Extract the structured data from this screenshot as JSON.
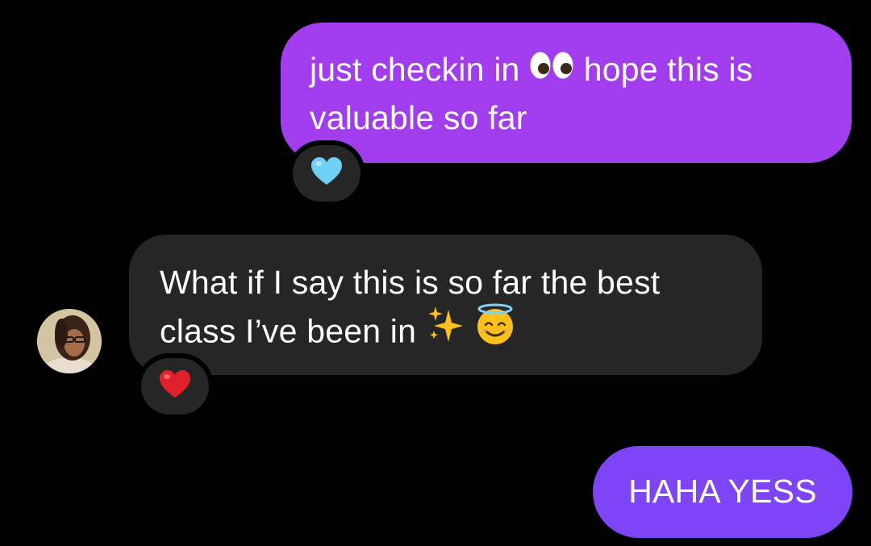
{
  "messages": [
    {
      "sender": "me",
      "lines": [
        "just checkin in",
        "hope this is",
        "valuable so far"
      ],
      "emoji": [
        "eyes-emoji"
      ],
      "reaction": "light-blue-heart-emoji",
      "color": "#a13ded"
    },
    {
      "sender": "other",
      "lines": [
        "What if I say this is so far the best",
        "class I’ve been in"
      ],
      "emoji": [
        "sparkles-emoji",
        "smiling-face-with-halo-emoji"
      ],
      "reaction": "red-heart-emoji",
      "color": "#262626"
    },
    {
      "sender": "me",
      "lines": [
        "HAHA YESS"
      ],
      "color": "#7d45f5"
    }
  ],
  "theme": {
    "background": "#000000",
    "text": "#ffffff",
    "reaction_bg": "#262626"
  }
}
